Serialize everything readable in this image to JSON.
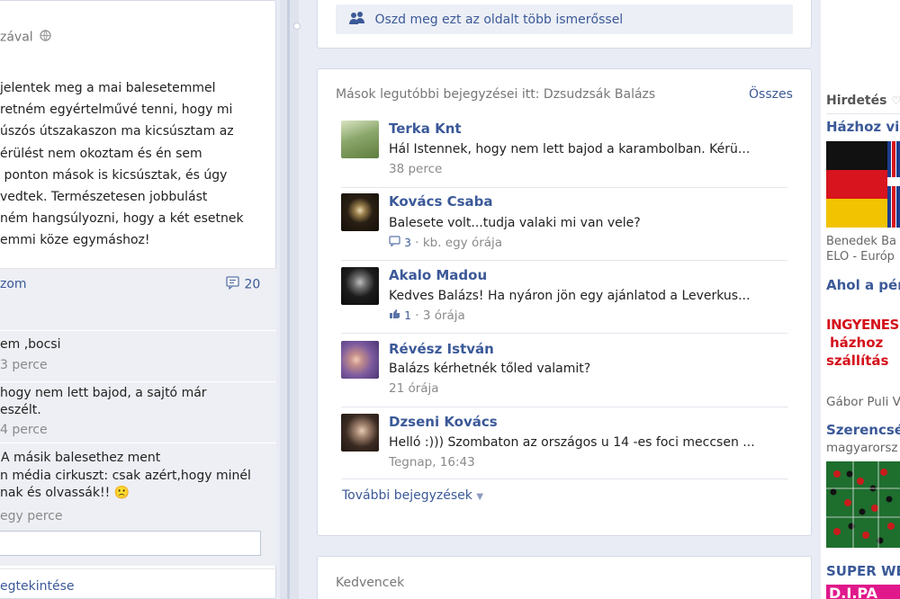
{
  "left_post": {
    "partial_header": "zával",
    "body_lines": [
      "jelentek meg a mai balesetemmel",
      "retném egyértelművé tenni, hogy mi",
      "úszós útszakaszon ma kicsúsztam az",
      "érülést nem okoztam és én sem",
      " ponton mások is kicsúsztak, és úgy",
      "vedtek. Természetesen jobbulást",
      "ném hangsúlyozni, hogy a két esetnek",
      "emmi köze egymáshoz!"
    ],
    "action_fragment": "zom",
    "comment_count": "20",
    "comments": [
      {
        "lines": [
          "em ,bocsi"
        ],
        "time": "3 perce"
      },
      {
        "lines": [
          "hogy nem lett bajod, a sajtó már",
          "eszélt."
        ],
        "time": "4 perce"
      },
      {
        "lines": [
          "A másik balesethez ment",
          "n média cirkuszt: csak azért,hogy minél",
          "nak és olvassák!!"
        ],
        "time": "egy perce",
        "emoji": "🙁"
      }
    ],
    "bottom_link": "egtekintése"
  },
  "share_bar": {
    "label": "Oszd meg ezt az oldalt több ismerőssel",
    "icon": "people-icon"
  },
  "recent_posts": {
    "title": "Mások legutóbbi bejegyzései itt: Dzsudzsák Balázs",
    "all_link": "Összes",
    "items": [
      {
        "name": "Terka Knt",
        "text": "Hál Istennek, hogy nem lett bajod a karambolban. Kérü...",
        "meta_count": "",
        "meta_icon": "",
        "time": "38 perce",
        "avatar_color": "#8aa66a"
      },
      {
        "name": "Kovács Csaba",
        "text": "Balesete volt...tudja valaki mi van vele?",
        "meta_count": "3",
        "meta_icon": "comment-icon",
        "time": "kb. egy órája",
        "avatar_color": "#3a2e1c"
      },
      {
        "name": "Akalo Madou",
        "text": "Kedves Balázs! Ha nyáron jön egy ajánlatod a Leverkus...",
        "meta_count": "1",
        "meta_icon": "like-icon",
        "time": "3 órája",
        "avatar_color": "#2a2a2a"
      },
      {
        "name": "Révész István",
        "text": "Balázs kérhetnék tőled valamit?",
        "meta_count": "",
        "meta_icon": "",
        "time": "21 órája",
        "avatar_color": "#9a7fb2"
      },
      {
        "name": "Dzseni Kovács",
        "text": "Helló :))) Szombaton az országos u 14 -es foci meccsen ...",
        "meta_count": "",
        "meta_icon": "",
        "time": "Tegnap, 16:43",
        "avatar_color": "#5a4a3e"
      }
    ],
    "more_link": "További bejegyzések"
  },
  "favorites": {
    "title": "Kedvencek"
  },
  "ads": {
    "header": "Hirdetés",
    "items": [
      {
        "title": "Házhoz vis",
        "sub": [
          "Benedek Ba",
          "ELO - Európ"
        ]
      },
      {
        "title": "Ahol a pén",
        "image_lines": [
          "INGYENES",
          "házhoz",
          "szállítás"
        ],
        "sub": [
          "Gábor Puli V"
        ]
      },
      {
        "title": "Szerencsé",
        "sub": [
          "magyarorsz"
        ]
      },
      {
        "title": "SUPER WE",
        "image_text": "D.I.PA"
      }
    ]
  },
  "colors": {
    "link": "#3b5998",
    "background": "#e9ecf4",
    "panel_border": "#d3d9e6"
  }
}
